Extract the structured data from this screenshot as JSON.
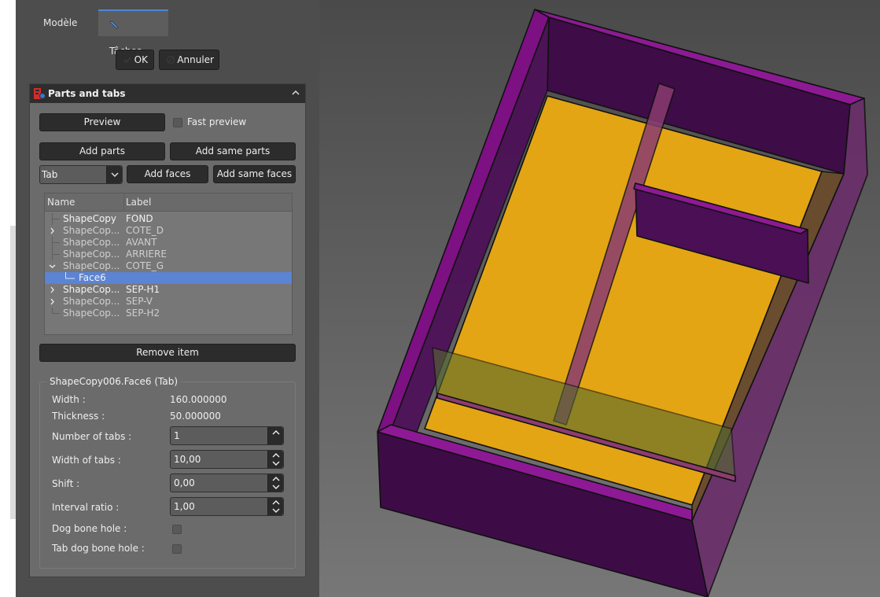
{
  "tabs": {
    "model": "Modèle",
    "tasks": "Tâches"
  },
  "dialog": {
    "ok": "OK",
    "cancel": "Annuler"
  },
  "group": {
    "title": "Parts and tabs"
  },
  "buttons": {
    "preview": "Preview",
    "fast_preview": "Fast preview",
    "add_parts": "Add parts",
    "add_same_parts": "Add same parts",
    "add_faces": "Add faces",
    "add_same_faces": "Add same faces",
    "remove_item": "Remove item"
  },
  "type_select": {
    "value": "Tab"
  },
  "tree": {
    "headers": {
      "name": "Name",
      "label": "Label"
    },
    "rows": [
      {
        "name": "ShapeCopy",
        "label": "FOND"
      },
      {
        "name": "ShapeCop...",
        "label": "COTE_D"
      },
      {
        "name": "ShapeCop...",
        "label": "AVANT"
      },
      {
        "name": "ShapeCop...",
        "label": "ARRIERE"
      },
      {
        "name": "ShapeCop...",
        "label": "COTE_G"
      },
      {
        "name": "Face6",
        "label": ""
      },
      {
        "name": "ShapeCop...",
        "label": "SEP-H1"
      },
      {
        "name": "ShapeCop...",
        "label": "SEP-V"
      },
      {
        "name": "ShapeCop...",
        "label": "SEP-H2"
      }
    ]
  },
  "props": {
    "legend": "ShapeCopy006.Face6 (Tab)",
    "width_label": "Width :",
    "width_value": "160.000000",
    "thickness_label": "Thickness :",
    "thickness_value": "50.000000",
    "num_tabs_label": "Number of tabs :",
    "num_tabs_value": "1",
    "width_tabs_label": "Width of tabs :",
    "width_tabs_value": "10,00",
    "shift_label": "Shift :",
    "shift_value": "0,00",
    "interval_label": "Interval ratio :",
    "interval_value": "1,00",
    "dog_bone_label": "Dog bone hole :",
    "tab_dog_bone_label": "Tab dog bone hole :"
  },
  "colors": {
    "panel": "#6b6b6b",
    "selection": "#5b84d4",
    "part_purple": "#7d1083",
    "part_yellow": "#e3a514"
  },
  "icons": [
    "pen-icon",
    "check-icon",
    "cancel-icon",
    "freecad-logo-icon",
    "chevron-up-icon",
    "chevron-down-icon",
    "expand-arrow-icon",
    "spin-arrows-icon"
  ]
}
